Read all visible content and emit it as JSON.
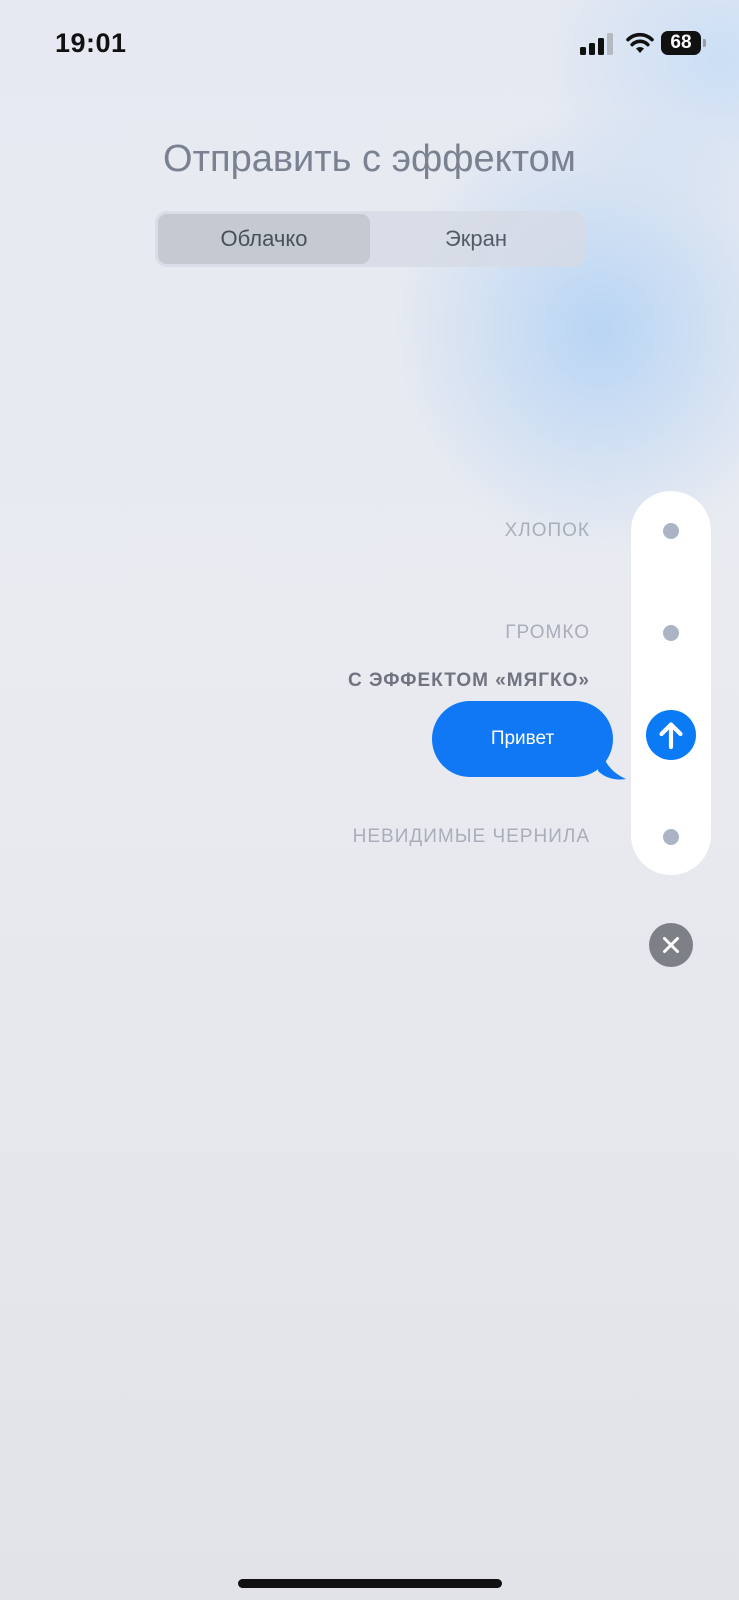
{
  "status_bar": {
    "time": "19:01",
    "battery": "68",
    "signal_icon": "cellular-signal-icon",
    "wifi_icon": "wifi-icon"
  },
  "title": "Отправить с эффектом",
  "segmented": {
    "tabs": [
      {
        "label": "Облачко",
        "active": true
      },
      {
        "label": "Экран",
        "active": false
      }
    ]
  },
  "effects": [
    {
      "label": "ХЛОПОК"
    },
    {
      "label": "ГРОМКО"
    },
    {
      "label": "С ЭФФЕКТОМ «МЯГКО»",
      "selected": true
    },
    {
      "label": "НЕВИДИМЫЕ ЧЕРНИЛА"
    }
  ],
  "message": {
    "text": "Привет"
  },
  "colors": {
    "accent": "#0A7AF5",
    "bubble": "#1178F5",
    "picker_bg": "#FFFFFF",
    "close_bg": "#7D8086"
  },
  "icons": {
    "send": "arrow-up-icon",
    "close": "close-icon"
  }
}
